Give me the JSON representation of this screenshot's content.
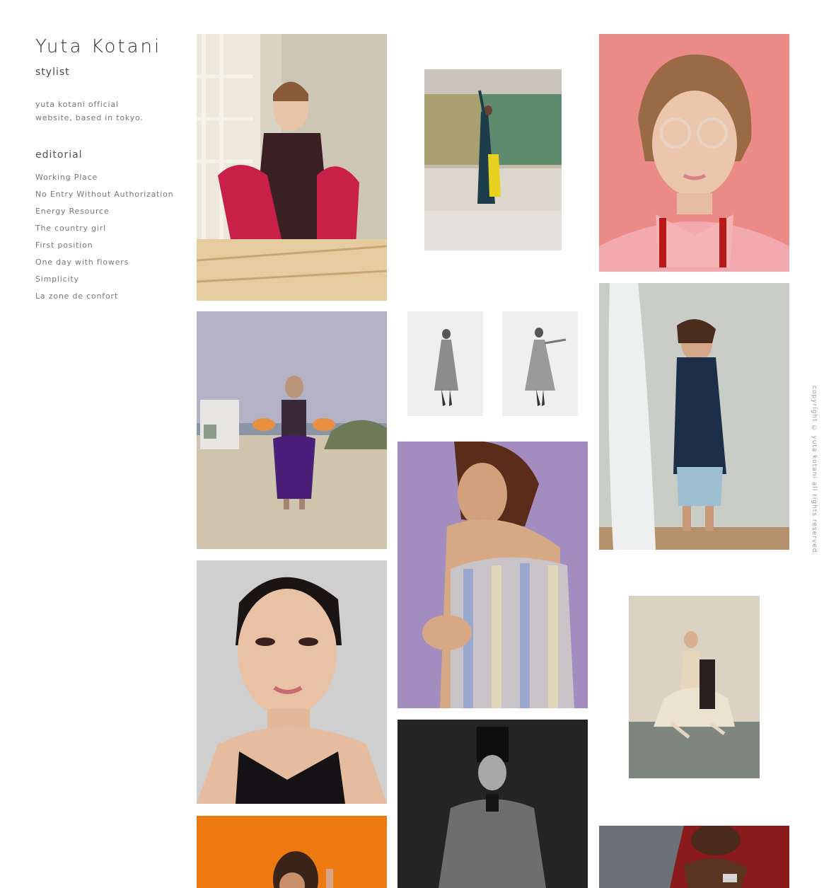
{
  "site": {
    "title": "Yuta Kotani",
    "subtitle": "stylist",
    "description": "yuta kotani official website, based in tokyo."
  },
  "sidebar": {
    "section_heading": "editorial",
    "items": [
      {
        "label": "Working Place"
      },
      {
        "label": "No Entry Without Authorization"
      },
      {
        "label": "Energy Resource"
      },
      {
        "label": "The country girl"
      },
      {
        "label": "First position"
      },
      {
        "label": "One day with flowers"
      },
      {
        "label": "Simplicity"
      },
      {
        "label": "La zone de confort"
      }
    ]
  },
  "footer": {
    "copyright": "copyright © yuta kotani all rights reserved."
  },
  "colors": {
    "background": "#ffffff",
    "text": "#4a4a4a",
    "muted": "#777777"
  }
}
